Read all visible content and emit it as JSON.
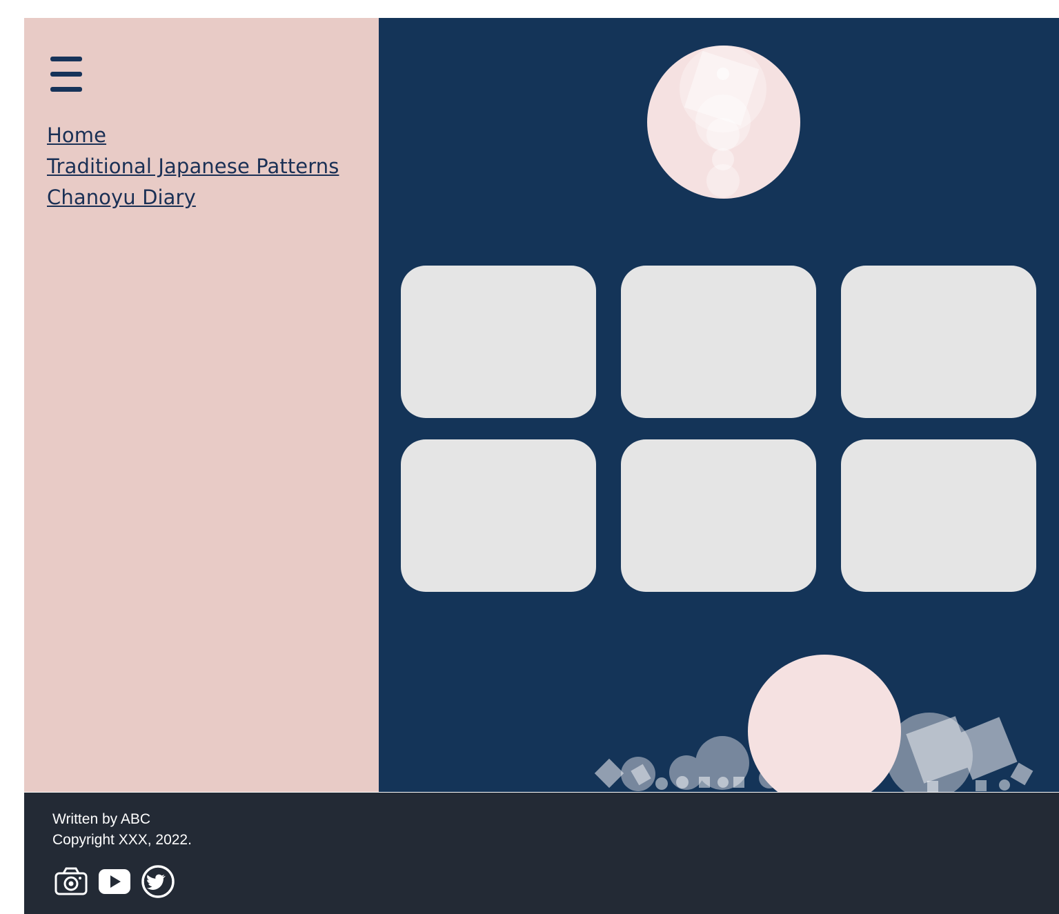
{
  "nav": {
    "menu_icon": "hamburger-menu-icon",
    "links": [
      "Home",
      "Traditional Japanese Patterns",
      "Chanoyu Diary"
    ]
  },
  "gallery": {
    "card_count": 6
  },
  "footer": {
    "author": "Written by ABC",
    "copyright": "Copyright XXX, 2022.",
    "social_icons": [
      "camera-icon",
      "youtube-icon",
      "twitter-icon"
    ]
  },
  "colors": {
    "sidebar_bg": "#e8cbc6",
    "main_bg": "#143458",
    "card_bg": "#e5e5e5",
    "footer_bg": "#232a35",
    "link": "#1a3055",
    "moon": "#f5e1e1"
  }
}
